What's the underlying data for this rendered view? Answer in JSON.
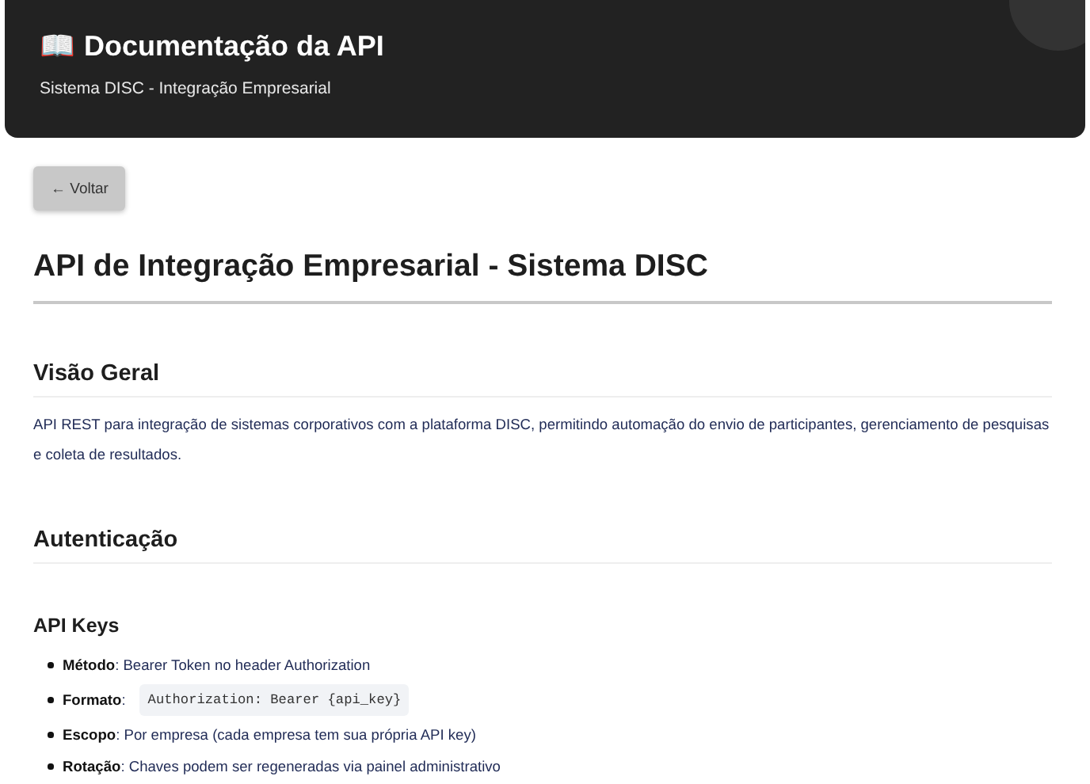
{
  "header": {
    "icon": "📖",
    "title": "Documentação da API",
    "subtitle": "Sistema DISC - Integração Empresarial"
  },
  "back_button": "← Voltar",
  "page_title": "API de Integração Empresarial - Sistema DISC",
  "sections": [
    {
      "heading": "Visão Geral",
      "paragraph": "API REST para integração de sistemas corporativos com a plataforma DISC, permitindo automação do envio de participantes, gerenciamento de pesquisas e coleta de resultados."
    },
    {
      "heading": "Autenticação",
      "subsections": [
        {
          "heading": "API Keys",
          "items": [
            {
              "kind": "text",
              "text": "**Método**: Bearer Token no header Authorization"
            },
            {
              "kind": "code",
              "text": "**Formato**:",
              "code": "Authorization: Bearer {api_key}"
            },
            {
              "kind": "text",
              "text": "**Escopo**: Por empresa (cada empresa tem sua própria API key)"
            },
            {
              "kind": "text",
              "text": "**Rotação**: Chaves podem ser regeneradas via painel administrativo"
            }
          ]
        }
      ]
    }
  ]
}
